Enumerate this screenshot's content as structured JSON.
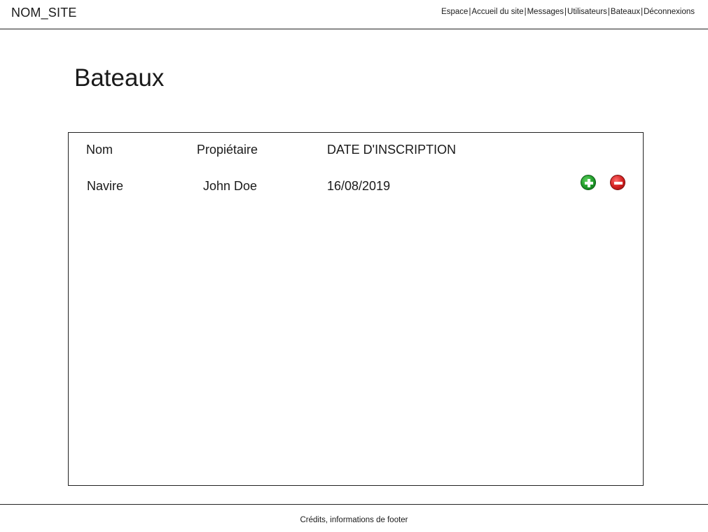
{
  "header": {
    "site_name": "NOM_SITE",
    "nav": [
      "Espace",
      "Accueil du site",
      "Messages",
      "Utilisateurs",
      "Bateaux",
      "Déconnexions"
    ],
    "separator": "|"
  },
  "main": {
    "title": "Bateaux",
    "table": {
      "columns": [
        "Nom",
        "Propiétaire",
        "DATE D'INSCRIPTION"
      ],
      "rows": [
        {
          "nom": "Navire",
          "proprietaire": "John Doe",
          "date": "16/08/2019"
        }
      ],
      "actions": {
        "add_icon": "plus-circle-icon",
        "remove_icon": "minus-circle-icon",
        "add_color": "#1f9a2a",
        "remove_color": "#d11f1f"
      }
    }
  },
  "footer": {
    "text": "Crédits, informations de footer"
  }
}
